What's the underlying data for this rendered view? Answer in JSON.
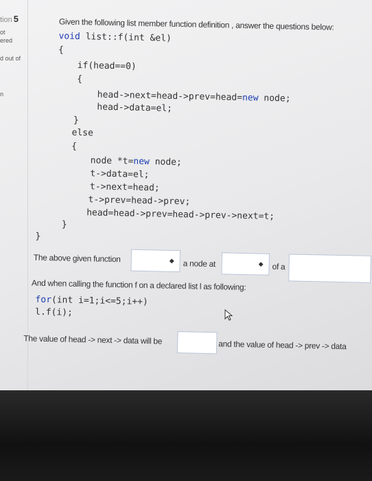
{
  "sidebar": {
    "question_prefix": "tion",
    "question_number": "5",
    "line1": "ot",
    "line2": "ered",
    "line3": "d out of",
    "line4": "n"
  },
  "instructions": "Given the following list member function definition , answer the questions below:",
  "code": {
    "l1_kw": "void",
    "l1_rest": " list::f(int &el)",
    "l2": "{",
    "l3": "if(head==0)",
    "l4": "{",
    "l5": "head->next=head->prev=head=",
    "l5_kw": "new",
    "l5_rest": " node;",
    "l6": "head->data=el;",
    "l7": "}",
    "l8": "else",
    "l9": "{",
    "l10a": "node *t=",
    "l10_kw": "new",
    "l10b": " node;",
    "l11": "t->data=el;",
    "l12": "t->next=head;",
    "l13": "t->prev=head->prev;",
    "l14": "head=head->prev=head->prev->next=t;",
    "l15": "}",
    "l16": "}"
  },
  "question1": {
    "part1": "The above given function",
    "part2": "a node at",
    "part3": "of a"
  },
  "calling_text": "And when calling the function f on a declared list l as following:",
  "loop": {
    "kw": "for",
    "line1_rest": "(int i=1;i<=5;i++)",
    "line2": "l.f(i);"
  },
  "question2": {
    "part1": "The value of head -> next -> data will be",
    "part2": "and the value of head -> prev -> data"
  },
  "select_arrow": "◆"
}
